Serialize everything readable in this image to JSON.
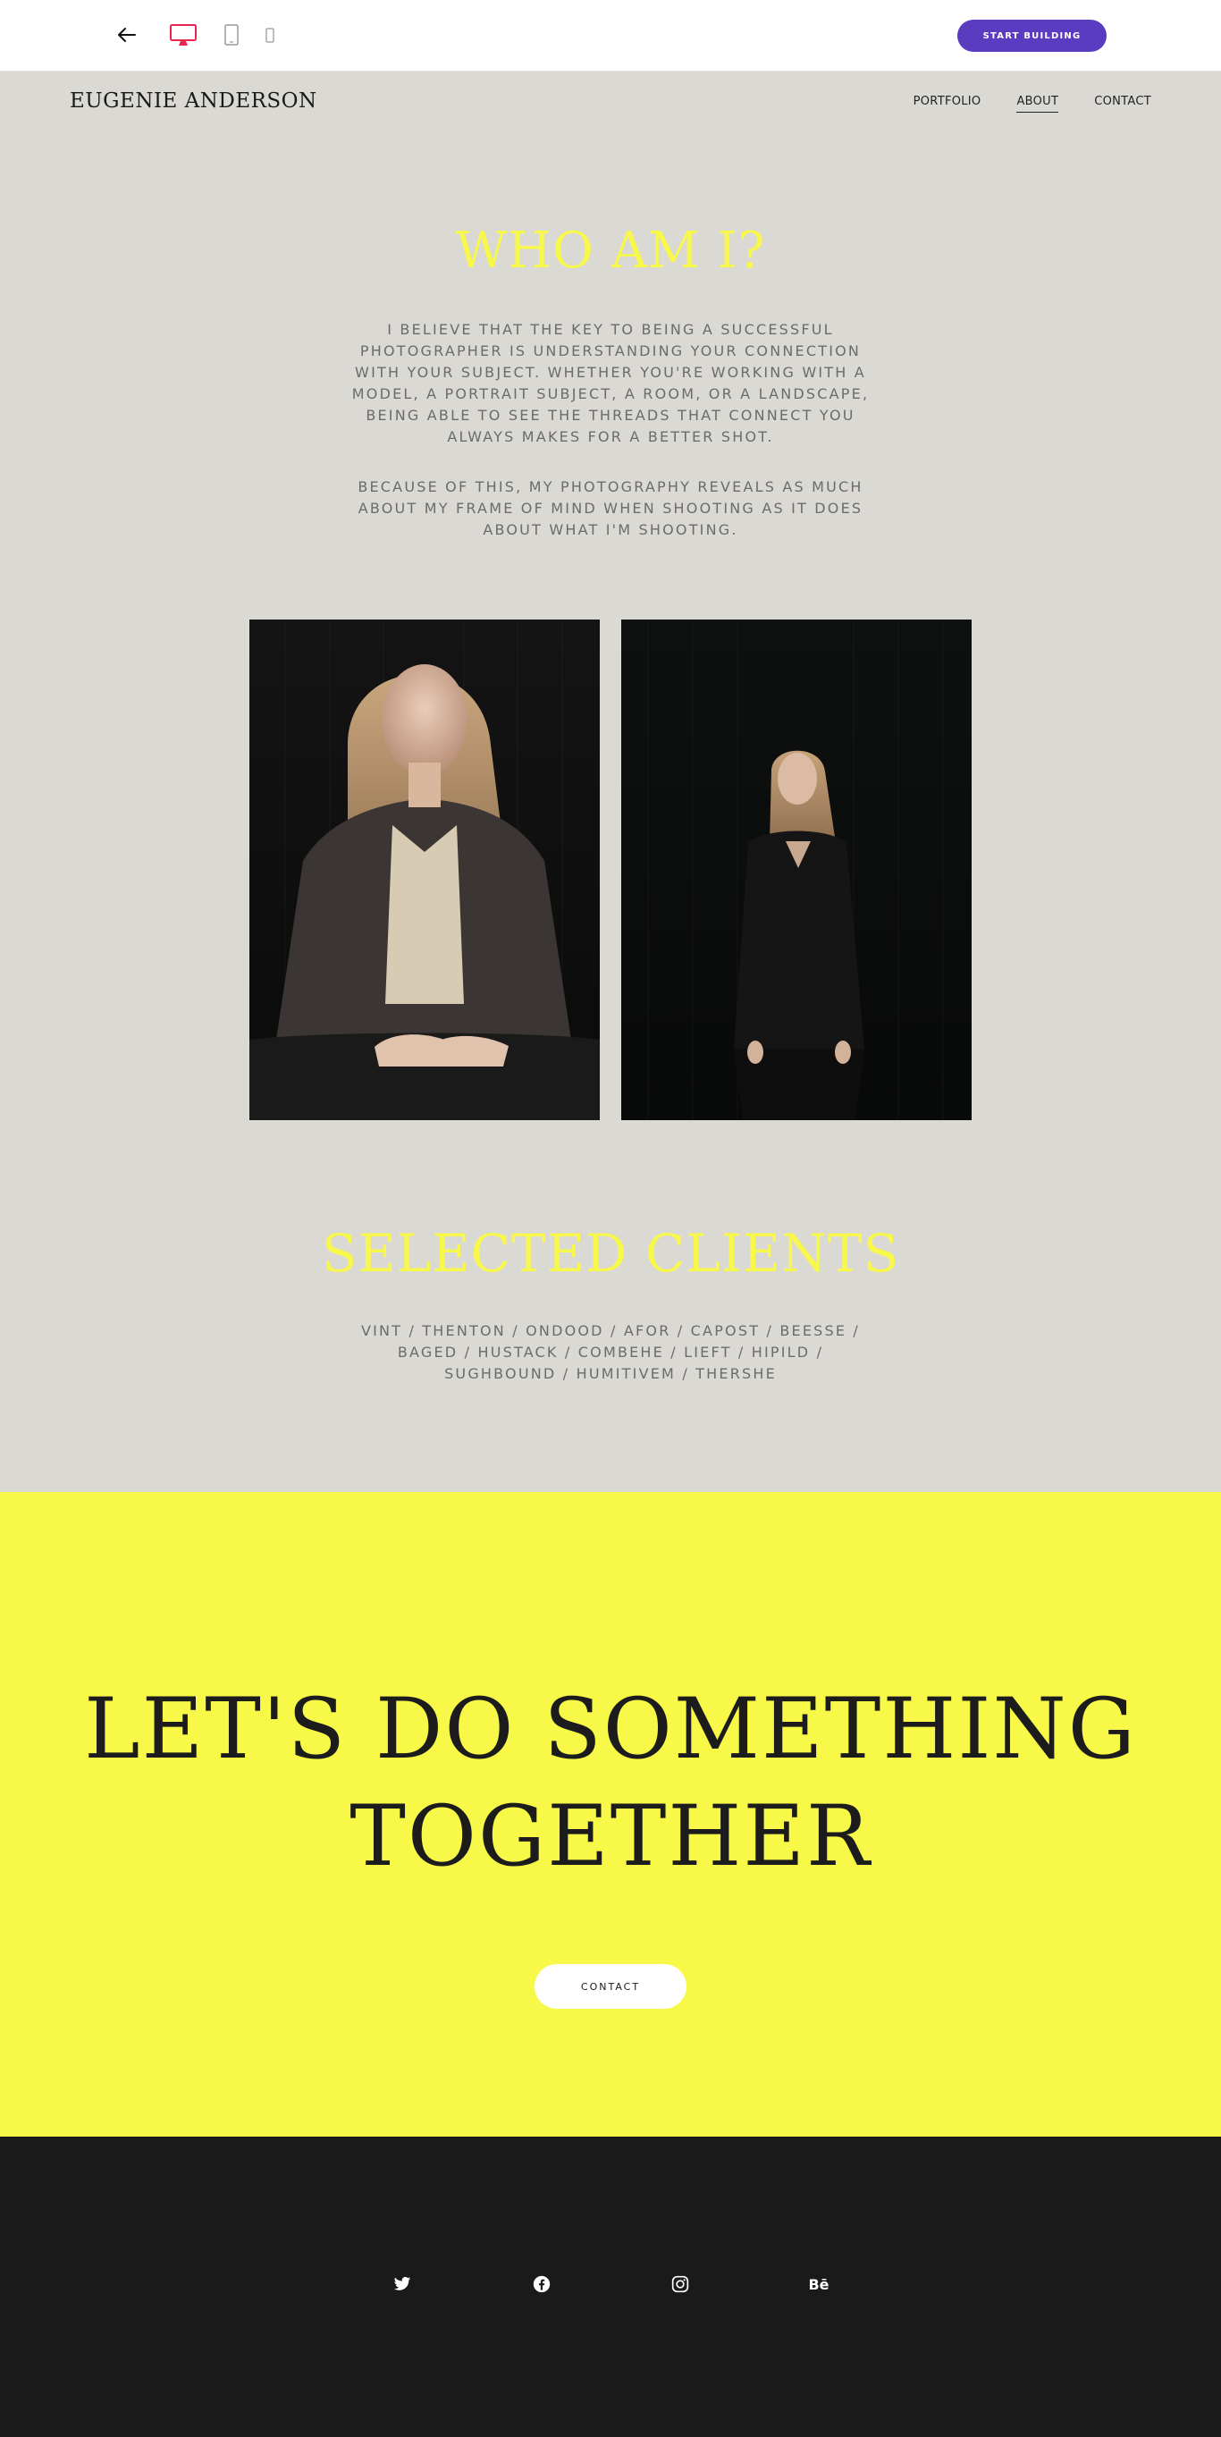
{
  "toolbar": {
    "back_icon": "arrow-left-icon",
    "devices": [
      {
        "name": "desktop",
        "icon": "desktop-icon",
        "active": true
      },
      {
        "name": "tablet",
        "icon": "tablet-icon",
        "active": false
      },
      {
        "name": "mobile",
        "icon": "mobile-icon",
        "active": false
      }
    ],
    "start_label": "START BUILDING"
  },
  "site": {
    "brand": "EUGENIE ANDERSON",
    "nav": [
      {
        "label": "PORTFOLIO",
        "active": false
      },
      {
        "label": "ABOUT",
        "active": true
      },
      {
        "label": "CONTACT",
        "active": false
      }
    ]
  },
  "about": {
    "title": "WHO AM I?",
    "paragraph1": "I BELIEVE THAT THE KEY TO BEING A SUCCESSFUL PHOTOGRAPHER IS UNDERSTANDING YOUR CONNECTION WITH YOUR SUBJECT. WHETHER YOU'RE WORKING WITH A MODEL, A PORTRAIT SUBJECT, A ROOM, OR A LANDSCAPE, BEING ABLE TO SEE THE THREADS THAT CONNECT YOU ALWAYS MAKES FOR A BETTER SHOT.",
    "paragraph2": "BECAUSE OF THIS, MY PHOTOGRAPHY REVEALS AS MUCH ABOUT MY FRAME OF MIND WHEN SHOOTING AS IT DOES ABOUT WHAT I'M SHOOTING."
  },
  "clients": {
    "title": "SELECTED CLIENTS",
    "list": "VINT / THENTON / ONDOOD / AFOR / CAPOST / BEESSE / BAGED / HUSTACK / COMBEHE / LIEFT / HIPILD / SUGHBOUND / HUMITIVEM / THERSHE"
  },
  "cta": {
    "line1": "LET'S DO SOMETHING",
    "line2": "TOGETHER",
    "button": "CONTACT"
  },
  "footer": {
    "social": [
      {
        "icon": "twitter-icon"
      },
      {
        "icon": "facebook-icon"
      },
      {
        "icon": "instagram-icon"
      },
      {
        "icon": "behance-icon",
        "label": "Bē"
      }
    ]
  },
  "colors": {
    "accent_yellow": "#f8f84a",
    "background": "#dbd9d4",
    "primary_button": "#5a3cc0",
    "footer": "#1a1a1a",
    "active_device": "#e8264f"
  }
}
